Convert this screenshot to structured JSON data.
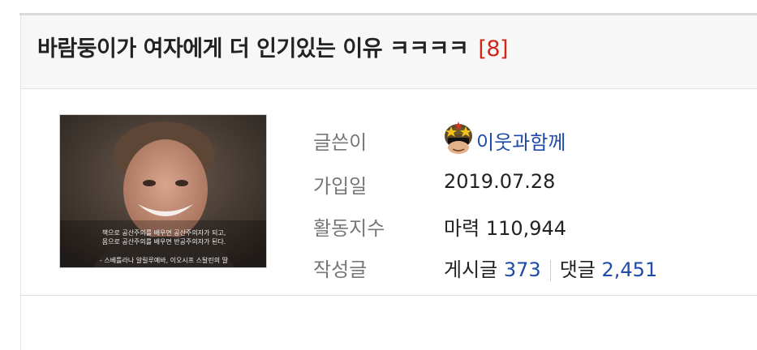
{
  "post": {
    "title": "바람둥이가 여자에게 더 인기있는 이유 ㅋㅋㅋㅋ",
    "comment_count": "[8]"
  },
  "profile": {
    "image_caption_line1": "책으로 공산주의를 배우면 공산주의자가 되고,",
    "image_caption_line2": "몸으로 공산주의를 배우면 반공주의자가 된다.",
    "image_caption_line3": "- 스베틀라나 알릴루예바, 이오시프 스탈린의 딸"
  },
  "info": {
    "author_label": "글쓴이",
    "author_name": "이웃과함께",
    "joined_label": "가입일",
    "joined_value": "2019.07.28",
    "activity_label": "활동지수",
    "activity_prefix": "마력",
    "activity_value": "110,944",
    "posts_label": "작성글",
    "posts_prefix": "게시글",
    "posts_count": "373",
    "comments_prefix": "댓글",
    "comments_count": "2,451"
  },
  "colors": {
    "link_blue": "#1e4aa8",
    "comment_count_red": "#d0261a",
    "label_gray": "#777777"
  }
}
